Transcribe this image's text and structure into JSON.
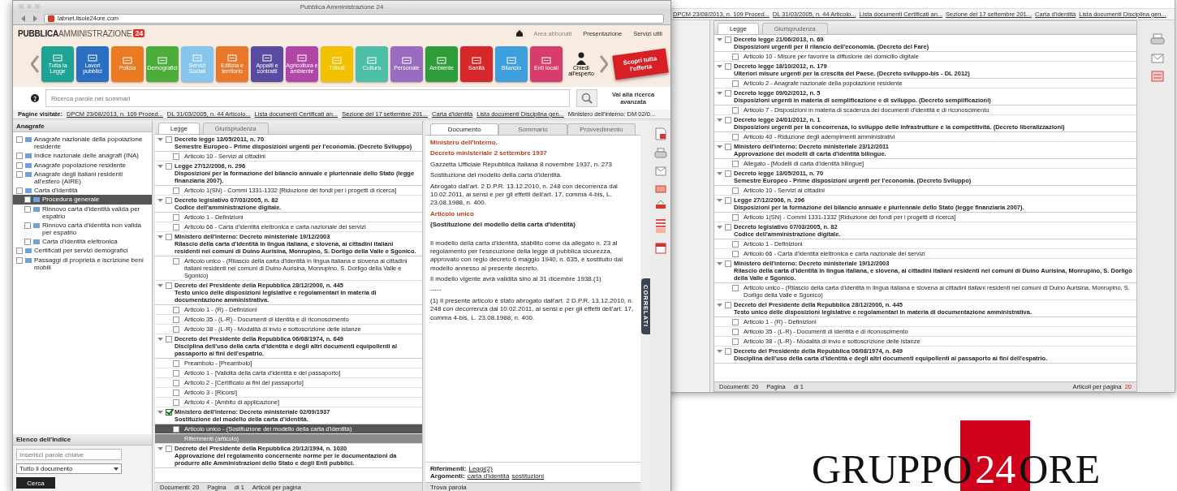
{
  "back_window": {
    "breadcrumb": [
      "DPCM 23/08/2013, n. 109 Proced...",
      "DL 31/03/2005, n. 44 Articolo...",
      "Lista documenti Certificati an...",
      "Sezione del 17 settembre 201...",
      "Carta d'identità",
      "Lista documenti Disciplina gen..."
    ],
    "tabs": [
      {
        "label": "Legge",
        "selected": true
      },
      {
        "label": "Giurisprudenza",
        "selected": false
      }
    ],
    "laws": [
      {
        "title": "Decreto legge 21/06/2013, n. 69",
        "subtitle": "Disposizioni urgenti per il rilancio dell'economia. (Decreto del Fare)",
        "checked": false,
        "articles": [
          {
            "label": "Articolo 10 - Misure per favorire la diffusione del domicilio digitale",
            "checked": false
          }
        ]
      },
      {
        "title": "Decreto legge 18/10/2012, n. 179",
        "subtitle": "Ulteriori misure urgenti per la crescita del Paese. (Decreto sviluppo-bis - DL 2012)",
        "checked": false,
        "articles": [
          {
            "label": "Articolo 2 - Anagrafe nazionale della popolazione residente",
            "checked": false
          }
        ]
      },
      {
        "title": "Decreto legge 09/02/2012, n. 5",
        "subtitle": "Disposizioni urgenti in materia di semplificazione e di sviluppo. (Decreto semplificazioni)",
        "checked": false,
        "articles": [
          {
            "label": "Articolo 7 - Disposizioni in materia di scadenza dei documenti d'identità e di riconoscimento",
            "checked": false
          }
        ]
      },
      {
        "title": "Decreto legge 24/01/2012, n. 1",
        "subtitle": "Disposizioni urgenti per la concorrenza, lo sviluppo delle infrastrutture e la competitività. (Decreto liberalizzazioni)",
        "checked": false,
        "articles": [
          {
            "label": "Articolo 40 - Riduzione degli adempimenti amministrativi",
            "checked": false
          }
        ]
      },
      {
        "title": "Ministero dell'interno: Decreto ministeriale 23/12/2011",
        "subtitle": "Approvazione dei modelli di carta d'identità bilingue.",
        "checked": false,
        "articles": [
          {
            "label": "Allegato - [Modelli di carta d'identità bilingue]",
            "checked": false
          }
        ]
      },
      {
        "title": "Decreto legge 13/05/2011, n. 70",
        "subtitle": "Semestre Europeo - Prime disposizioni urgenti per l'economia. (Decreto Sviluppo)",
        "checked": false,
        "articles": [
          {
            "label": "Articolo 10 - Servizi ai cittadini",
            "checked": false
          }
        ]
      },
      {
        "title": "Legge 27/12/2006, n. 296",
        "subtitle": "Disposizioni per la formazione del bilancio annuale e pluriennale dello Stato (legge finanziaria 2007).",
        "checked": false,
        "articles": [
          {
            "label": "Articolo 1(SN) - Commi 1331-1332 [Riduzione dei fondi per i progetti di ricerca]",
            "checked": false
          }
        ]
      },
      {
        "title": "Decreto legislativo 07/03/2005, n. 82",
        "subtitle": "Codice dell'amministrazione digitale.",
        "checked": false,
        "articles": [
          {
            "label": "Articolo 1 - Definizioni",
            "checked": false
          },
          {
            "label": "Articolo 66 - Carta d'identità elettronica e carta nazionale dei servizi",
            "checked": false
          }
        ]
      },
      {
        "title": "Ministero dell'interno: Decreto ministeriale 19/12/2003",
        "subtitle": "Rilascio della carta d'identità in lingua italiana, e slovena, ai cittadini italiani residenti nei comuni di Duino Aurisina, Monrupino, S. Dorligo della Valle e Sgonico.",
        "checked": false,
        "articles": [
          {
            "label": "Articolo unico - (Rilascio della carta d'identità in lingua italiana e slovena ai cittadini italiani residenti nei comuni di Duino Aurisina, Monrupino, S. Dorligo della Valle e Sgonico)",
            "checked": false
          }
        ]
      },
      {
        "title": "Decreto del Presidente della Repubblica 28/12/2000, n. 445",
        "subtitle": "Testo unico delle disposizioni legislative e regolamentari in materia di documentazione amministrativa.",
        "checked": false,
        "articles": [
          {
            "label": "Articolo 1 - (R) - Definizioni",
            "checked": false
          },
          {
            "label": "Articolo 35 - (L-R) - Documenti di identità e di riconoscimento",
            "checked": false
          },
          {
            "label": "Articolo 38 - (L-R) - Modalità di invio e sottoscrizione delle istanze",
            "checked": false
          }
        ]
      },
      {
        "title": "Decreto del Presidente della Repubblica 06/08/1974, n. 649",
        "subtitle": "Disciplina dell'uso della carta d'identità e degli altri documenti equipollenti al passaporto ai fini dell'espatrio.",
        "checked": false
      }
    ],
    "footer": {
      "count": "Documenti: 20",
      "page": "Pagina",
      "of": "di 1",
      "per_page": "Articoli per pagina",
      "per_page_value": "20"
    }
  },
  "front_window": {
    "title": "Pubblica Amministrazione 24",
    "url": "labnet.ilsole24ore.com",
    "brand": {
      "name_bold": "PUBBLICA",
      "name_light": "AMMINISTRAZIONE",
      "badge": "24"
    },
    "header_links": [
      "Area abbonati",
      "Presentazione",
      "Servizi utili"
    ],
    "tiles": [
      {
        "label": "Tutta la Legge",
        "color": "#1fa394"
      },
      {
        "label": "Lavori pubblici",
        "color": "#2b6fc0"
      },
      {
        "label": "Polizia",
        "color": "#ec7a22"
      },
      {
        "label": "Demografici",
        "color": "#4cad3b"
      },
      {
        "label": "Servizi Sociali",
        "color": "#86c6ec"
      },
      {
        "label": "Edilizia e territorio",
        "color": "#e9782b"
      },
      {
        "label": "Appalti e contratti",
        "color": "#5a4aa0"
      },
      {
        "label": "Agricoltura e ambiente",
        "color": "#b046a6"
      },
      {
        "label": "Tributi",
        "color": "#f2c200"
      },
      {
        "label": "Cultura",
        "color": "#4dbfa6"
      },
      {
        "label": "Personale",
        "color": "#9a6cbf"
      },
      {
        "label": "Ambiente",
        "color": "#2e9d3a"
      },
      {
        "label": "Sanità",
        "color": "#d6282a"
      },
      {
        "label": "Bilancio",
        "color": "#3e9fdd"
      },
      {
        "label": "Enti locali",
        "color": "#d63c6c"
      }
    ],
    "expert": "Chiedi all'esperto",
    "offer": "Scopri tutta l'offerta",
    "search": {
      "placeholder": "Ricerca parole nei sommari",
      "advanced": "Vai alla ricerca avanzata"
    },
    "visited_label": "Pagine visitate:",
    "visited": [
      "DPCM 23/08/2013, n. 109 Proced...",
      "DL 31/03/2005, n. 44 Articolo...",
      "Lista documenti Certificati an...",
      "Sezione del 17 settembre 201...",
      "Carta d'identità",
      "Lista documenti Disciplina gen...",
      "Ministero dell'interno: DM 02/0..."
    ],
    "tree_title": "Anagrafe",
    "tree": [
      {
        "label": "Anagrafe nazionale della popolazione residente",
        "selected": false
      },
      {
        "label": "Indice nazionale delle anagrafi (INA)",
        "selected": false
      },
      {
        "label": "Anagrafe popolazione residente",
        "selected": false
      },
      {
        "label": "Anagrafe degli italiani residenti all'estero (AIRE)",
        "selected": false
      },
      {
        "label": "Carta d'identità",
        "selected": false,
        "children": [
          {
            "label": "Procedura generale",
            "selected": true
          },
          {
            "label": "Rinnovo carta d'identità valida per espatrio",
            "selected": false
          },
          {
            "label": "Rinnovo carta d'identità non valida per espatrio",
            "selected": false
          },
          {
            "label": "Carta d'identità elettronica",
            "selected": false
          }
        ]
      },
      {
        "label": "Certificati per servizi demografici",
        "selected": false
      },
      {
        "label": "Passaggi di proprietà e iscrizione beni mobili",
        "selected": false
      }
    ],
    "index_panel": {
      "title": "Elenco dell'Indice",
      "placeholder": "Inserisci parole chiave",
      "scope": "Tutto il documento",
      "button": "Cerca"
    },
    "tabs": [
      {
        "label": "Legge",
        "selected": true
      },
      {
        "label": "Giurisprudenza",
        "selected": false
      }
    ],
    "laws": [
      {
        "title": "Decreto legge 13/05/2011, n. 70",
        "subtitle": "Semestre Europeo - Prime disposizioni urgenti per l'economia. (Decreto Sviluppo)",
        "checked": false,
        "articles": [
          {
            "label": "Articolo 10 - Servizi ai cittadini",
            "kind": "article",
            "selected": false
          }
        ]
      },
      {
        "title": "Legge 27/12/2006, n. 296",
        "subtitle": "Disposizioni per la formazione del bilancio annuale e pluriennale dello Stato (legge finanziaria 2007).",
        "checked": false,
        "articles": [
          {
            "label": "Articolo 1(SN) - Commi 1331-1332 [Riduzione dei fondi per i progetti di ricerca]",
            "kind": "article",
            "selected": false
          }
        ]
      },
      {
        "title": "Decreto legislativo 07/03/2005, n. 82",
        "subtitle": "Codice dell'amministrazione digitale.",
        "checked": false,
        "articles": [
          {
            "label": "Articolo 1 - Definizioni",
            "kind": "article",
            "selected": false
          },
          {
            "label": "Articolo 66 - Carta d'identità elettronica e carta nazionale dei servizi",
            "kind": "article",
            "selected": false
          }
        ]
      },
      {
        "title": "Ministero dell'interno: Decreto ministeriale 19/12/2003",
        "subtitle": "Rilascio della carta d'identità in lingua italiana, e slovena, ai cittadini italiani residenti nei comuni di Duino Aurisina, Monrupino, S. Dorligo della Valle e Sgonico.",
        "checked": false,
        "articles": [
          {
            "label": "Articolo unico - (Rilascio della carta d'identità in lingua italiana e slovena ai cittadini italiani residenti nei comuni di Duino Aurisina, Monrupino, S. Dorligo della Valle e Sgonico)",
            "kind": "article",
            "selected": false
          }
        ]
      },
      {
        "title": "Decreto del Presidente della Repubblica 28/12/2000, n. 445",
        "subtitle": "Testo unico delle disposizioni legislative e regolamentari in materia di documentazione amministrativa.",
        "checked": false,
        "articles": [
          {
            "label": "Articolo 1 - (R) - Definizioni",
            "kind": "article",
            "selected": false
          },
          {
            "label": "Articolo 35 - (L-R) - Documenti di identità e di riconoscimento",
            "kind": "article",
            "selected": false
          },
          {
            "label": "Articolo 38 - (L-R) - Modalità di invio e sottoscrizione delle istanze",
            "kind": "article",
            "selected": false
          }
        ]
      },
      {
        "title": "Decreto del Presidente della Repubblica 06/08/1974, n. 649",
        "subtitle": "Disciplina dell'uso della carta d'identità e degli altri documenti equipollenti al passaporto ai fini dell'espatrio.",
        "checked": false,
        "articles": [
          {
            "label": "Preambolo - [Preambolo]",
            "kind": "article",
            "selected": false
          },
          {
            "label": "Articolo 1 - [Validità della carta d'identità e del passaporto]",
            "kind": "article",
            "selected": false
          },
          {
            "label": "Articolo 2 - [Certificato ai fini del passaporto]",
            "kind": "article",
            "selected": false
          },
          {
            "label": "Articolo 3 - [Ricorsi]",
            "kind": "article",
            "selected": false
          },
          {
            "label": "Articolo 4 - [Ambito di applicazione]",
            "kind": "article",
            "selected": false
          }
        ]
      },
      {
        "title": "Ministero dell'interno: Decreto ministeriale 02/09/1937",
        "subtitle": "Sostituzione del modello della carta d'identità.",
        "checked": true,
        "articles": [
          {
            "label": "Articolo unico - (Sostituzione del modello della carta d'identità)",
            "kind": "article",
            "selected": true
          },
          {
            "label": "Riferimenti (articolo)",
            "kind": "reference",
            "selected": false
          }
        ]
      },
      {
        "title": "Decreto del Presidente della Repubblica 20/12/1994, n. 1030",
        "subtitle": "Approvazione del regolamento concernente norme per le documentazioni da produrre alle Amministrazioni dello Stato e degli Enti pubblici.",
        "checked": false
      }
    ],
    "list_footer": {
      "count": "Documenti: 20",
      "page": "Pagina",
      "of": "di 1",
      "per_page": "Articoli per pagina"
    },
    "doc_tabs": [
      {
        "label": "Documento",
        "selected": true
      },
      {
        "label": "Sommario",
        "selected": false
      },
      {
        "label": "Provvedimento",
        "selected": false
      }
    ],
    "doc": [
      {
        "kind": "heading",
        "text": "Ministero dell'interno."
      },
      {
        "kind": "heading",
        "text": "Decreto ministeriale 2 settembre 1937"
      },
      {
        "kind": "text",
        "text": "Gazzetta Ufficiale Repubblica Italiana 8 novembre 1937, n. 273"
      },
      {
        "kind": "text",
        "text": "Sostituzione del modello della carta d'identità."
      },
      {
        "kind": "text",
        "text": "Abrogato dall'art. 2 D.P.R. 13.12.2010, n. 248 con decorrenza dal 10.02.2011, ai sensi e per gli effetti dell'art. 17, comma 4-bis, L. 23.08.1988, n. 400."
      },
      {
        "kind": "heading",
        "text": "Articolo unico"
      },
      {
        "kind": "bold",
        "text": "(Sostituzione del modello della carta d'identità)"
      },
      {
        "kind": "text",
        "text": "Il modello della carta d'identità, stabilito come da allegato n. 23 al regolamento per l'esecuzione della legge di pubblica sicurezza, approvato con regio decreto 6 maggio 1940, n. 635, è sostituito dal modello annesso al presente decreto."
      },
      {
        "kind": "text",
        "text": "Il modello vigente avrà validità sino al 31 dicembre 1938.(1)"
      },
      {
        "kind": "text",
        "text": "-----"
      },
      {
        "kind": "text",
        "text": "(1) Il presente articolo è stato abrogato dall'art. 2 D.P.R. 13.12.2010, n. 248 con decorrenza dal 10.02.2011, ai sensi e per gli effetti dell'art. 17, comma 4-bis, L. 23.08.1988, n. 400."
      }
    ],
    "refs": [
      {
        "label": "Riferimenti:",
        "links": [
          "Leggi(2)"
        ]
      },
      {
        "label": "Argomenti:",
        "links": [
          "carta d'identità",
          "sostituzioni"
        ]
      }
    ],
    "find": "Trova parola",
    "related": "CORRELATI"
  },
  "logo": {
    "left": "GRUPPO",
    "middle": "24",
    "right": "ORE"
  }
}
